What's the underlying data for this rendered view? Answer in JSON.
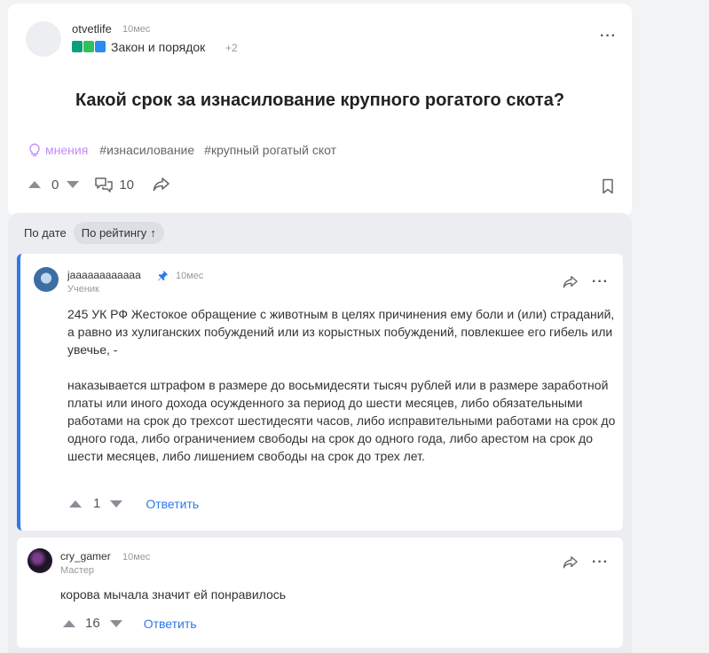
{
  "question": {
    "author": "otvetlife",
    "time": "10мес",
    "category": "Закон и порядок",
    "category_more": "+2",
    "title": "Какой срок за изнасилование крупного рогатого скота?",
    "tags": {
      "opinion": "мнения",
      "items": [
        "#изнасилование",
        "#крупный рогатый скот"
      ]
    },
    "votes": "0",
    "comments_count": "10"
  },
  "sort": {
    "by_date": "По дате",
    "by_rating": "По рейтингу",
    "arrow": "↑"
  },
  "answers": [
    {
      "author": "jaaaaaaaaaaaa",
      "time": "10мес",
      "rank": "Ученик",
      "paragraphs": [
        "245 УК РФ Жестокое обращение с животным в целях причинения ему боли и (или) страданий, а равно из хулиганских побуждений или из корыстных побуждений, повлекшее его гибель или увечье, -",
        "наказывается штрафом в размере до восьмидесяти тысяч рублей или в размере заработной платы или иного дохода осужденного за период до шести месяцев, либо обязательными работами на срок до трехсот шестидесяти часов, либо исправительными работами на срок до одного года, либо ограничением свободы на срок до одного года, либо арестом на срок до шести месяцев, либо лишением свободы на срок до трех лет."
      ],
      "votes": "1",
      "reply": "Ответить"
    },
    {
      "author": "cry_gamer",
      "time": "10мес",
      "rank": "Мастер",
      "paragraphs": [
        "корова мычала значит ей понравилось"
      ],
      "votes": "16",
      "reply": "Ответить"
    }
  ],
  "icons": {
    "more": "more-dots-icon",
    "upvote": "triangle-up-icon",
    "downvote": "triangle-down-icon",
    "comments": "comments-icon",
    "share": "share-arrow-icon",
    "bookmark": "bookmark-icon",
    "pin": "pin-icon",
    "opinion": "lightbulb-icon"
  },
  "colors": {
    "accent_blue": "#2e77f0",
    "opinion_purple": "#c58af9",
    "page_bg": "#f2f3f5"
  }
}
